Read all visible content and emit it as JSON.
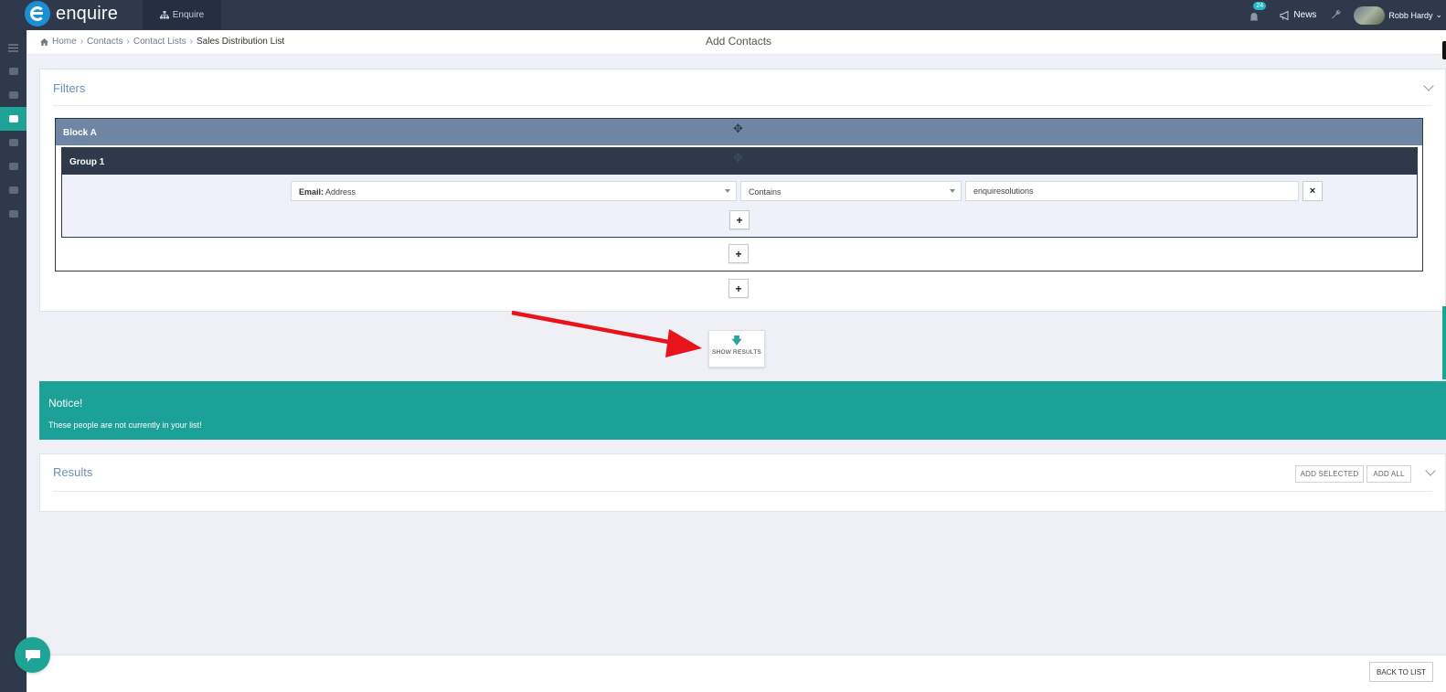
{
  "app": {
    "name": "enquire",
    "tab_label": "Enquire"
  },
  "topbar": {
    "notification_count": "24",
    "news_label": "News",
    "user_name": "Robb Hardy"
  },
  "breadcrumb": [
    "Home",
    "Contacts",
    "Contact Lists",
    "Sales Distribution List"
  ],
  "page_title": "Add Contacts",
  "filters": {
    "title": "Filters",
    "block_label": "Block A",
    "group_label": "Group 1",
    "rule": {
      "field_prefix": "Email:",
      "field_value": "Address",
      "operator": "Contains",
      "value": "enquiresolutions"
    },
    "add_symbol": "+",
    "remove_symbol": "×"
  },
  "show_results_label": "SHOW RESULTS",
  "notice": {
    "title": "Notice!",
    "text": "These people are not currently in your list!"
  },
  "results": {
    "title": "Results",
    "add_selected_label": "ADD SELECTED",
    "add_all_label": "ADD ALL"
  },
  "footer": {
    "back_label": "BACK TO LIST"
  },
  "colors": {
    "topbar": "#2e3a4b",
    "accent_teal": "#1ca198",
    "block_header": "#6e86a4",
    "annotation_arrow": "#e8141b"
  }
}
